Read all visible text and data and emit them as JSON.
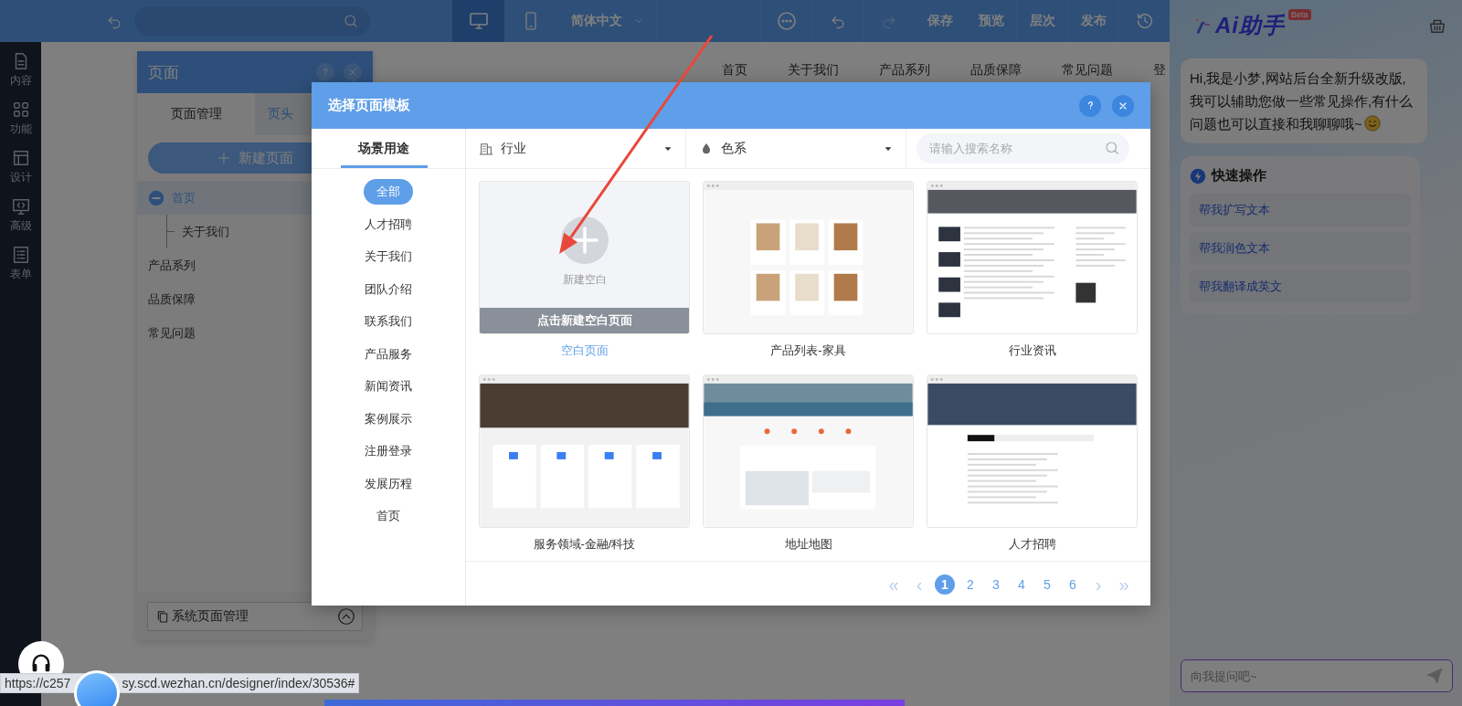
{
  "top_bar": {
    "devices": [
      {
        "kind": "desktop",
        "selected": true
      },
      {
        "kind": "mobile",
        "selected": false
      }
    ],
    "language": "简体中文",
    "actions": [
      "保存",
      "预览",
      "层次",
      "发布"
    ]
  },
  "sidebar": {
    "items": [
      {
        "kind": "content",
        "label": "内容"
      },
      {
        "kind": "function",
        "label": "功能"
      },
      {
        "kind": "design",
        "label": "设计"
      },
      {
        "kind": "advanced",
        "label": "高级"
      },
      {
        "kind": "form",
        "label": "表单"
      }
    ]
  },
  "canvas_nav": [
    "首页",
    "关于我们",
    "产品系列",
    "品质保障",
    "常见问题",
    "登"
  ],
  "page_panel": {
    "title": "页面",
    "tabs": [
      {
        "label": "页面管理",
        "selected": true
      },
      {
        "label": "页头",
        "selected": false
      }
    ],
    "new_button": "新建页面",
    "tree": [
      {
        "label": "首页",
        "selected": true,
        "expanded": true,
        "children": [
          {
            "label": "关于我们",
            "selected": false
          }
        ]
      },
      {
        "label": "产品系列",
        "selected": false
      },
      {
        "label": "品质保障",
        "selected": false
      },
      {
        "label": "常见问题",
        "selected": false
      }
    ],
    "footer_button": "系统页面管理"
  },
  "modal": {
    "title": "选择页面模板",
    "side_tab": "场景用途",
    "categories": [
      {
        "label": "全部",
        "selected": true
      },
      {
        "label": "人才招聘",
        "selected": false
      },
      {
        "label": "关于我们",
        "selected": false
      },
      {
        "label": "团队介绍",
        "selected": false
      },
      {
        "label": "联系我们",
        "selected": false
      },
      {
        "label": "产品服务",
        "selected": false
      },
      {
        "label": "新闻资讯",
        "selected": false
      },
      {
        "label": "案例展示",
        "selected": false
      },
      {
        "label": "注册登录",
        "selected": false
      },
      {
        "label": "发展历程",
        "selected": false
      },
      {
        "label": "首页",
        "selected": false
      }
    ],
    "filters": [
      {
        "kind": "industry",
        "label": "行业"
      },
      {
        "kind": "color",
        "label": "色系"
      }
    ],
    "search": {
      "placeholder": "请输入搜索名称"
    },
    "templates": [
      {
        "kind": "blank",
        "label": "空白页面",
        "plus_caption": "新建空白",
        "action": "点击新建空白页面",
        "selected": true
      },
      {
        "kind": "products",
        "label": "产品列表-家具",
        "selected": false
      },
      {
        "kind": "news",
        "label": "行业资讯",
        "selected": false
      },
      {
        "kind": "service",
        "label": "服务领域-金融/科技",
        "selected": false
      },
      {
        "kind": "map",
        "label": "地址地图",
        "selected": false
      },
      {
        "kind": "jobs",
        "label": "人才招聘",
        "selected": false
      }
    ],
    "pagination": {
      "first": "«",
      "prev": "‹",
      "pages": [
        {
          "label": "1",
          "selected": true
        },
        {
          "label": "2",
          "selected": false
        },
        {
          "label": "3",
          "selected": false
        },
        {
          "label": "4",
          "selected": false
        },
        {
          "label": "5",
          "selected": false
        },
        {
          "label": "6",
          "selected": false
        }
      ],
      "next": "›",
      "last": "»"
    }
  },
  "assistant": {
    "title": "Ai助手",
    "badge": "Beta",
    "greeting": "Hi,我是小梦,网站后台全新升级改版,我可以辅助您做一些常见操作,有什么问题也可以直接和我聊聊哦~",
    "quick_title": "快速操作",
    "quick_actions": [
      "帮我扩写文本",
      "帮我润色文本",
      "帮我翻译成英文"
    ],
    "input": {
      "placeholder": "向我提问吧~"
    }
  },
  "status_bar": {
    "url_start": "https://c257",
    "url_end": "sy.scd.wezhan.cn/designer/index/30536#"
  }
}
